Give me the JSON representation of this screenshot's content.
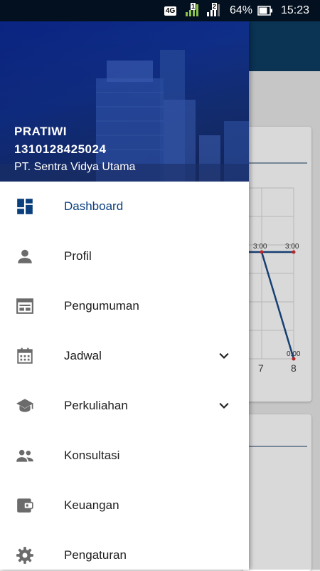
{
  "status_bar": {
    "network": "4G",
    "sim1": "1",
    "sim2": "2",
    "battery": "64%",
    "time": "15:23"
  },
  "drawer": {
    "user": {
      "name": "PRATIWI",
      "id": "1310128425024",
      "organization": "PT. Sentra Vidya Utama"
    },
    "menu": [
      {
        "label": "Dashboard",
        "icon": "dashboard-icon",
        "active": true
      },
      {
        "label": "Profil",
        "icon": "person-icon"
      },
      {
        "label": "Pengumuman",
        "icon": "announcement-icon"
      },
      {
        "label": "Jadwal",
        "icon": "calendar-icon",
        "expandable": true
      },
      {
        "label": "Perkuliahan",
        "icon": "graduation-cap-icon",
        "expandable": true
      },
      {
        "label": "Konsultasi",
        "icon": "people-icon"
      },
      {
        "label": "Keuangan",
        "icon": "wallet-icon"
      },
      {
        "label": "Pengaturan",
        "icon": "gear-icon"
      }
    ]
  },
  "background_chart": {
    "point_labels": [
      "3:00",
      "3:00",
      "0:00"
    ],
    "x_ticks": [
      "7",
      "8"
    ]
  },
  "colors": {
    "accent": "#0a3f7e",
    "icon_gray": "#6b6b6b",
    "statusbar": "#03101f",
    "appbar": "#0c3c63"
  }
}
